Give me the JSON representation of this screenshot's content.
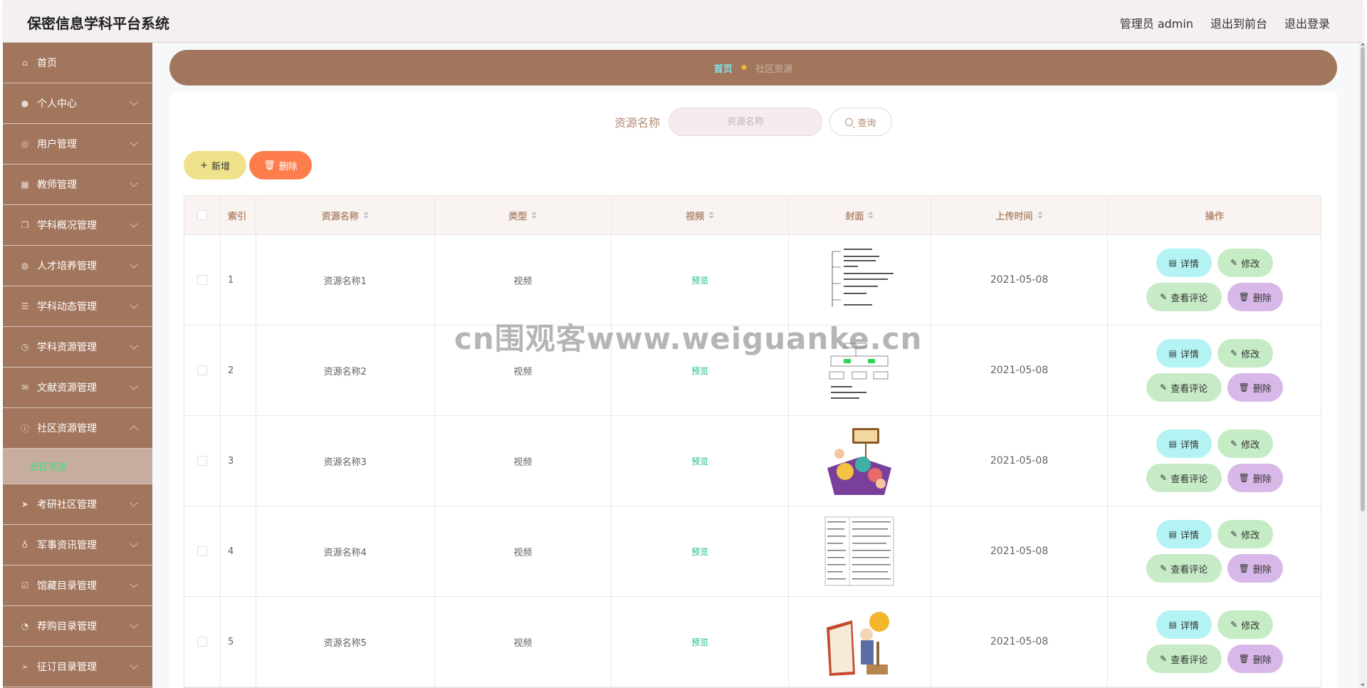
{
  "header": {
    "title": "保密信息学科平台系统",
    "user": "管理员 admin",
    "to_front": "退出到前台",
    "logout": "退出登录"
  },
  "sidebar": {
    "items": [
      {
        "label": "首页",
        "icon": "home-icon"
      },
      {
        "label": "个人中心",
        "icon": "user-icon"
      },
      {
        "label": "用户管理",
        "icon": "users-icon"
      },
      {
        "label": "教师管理",
        "icon": "grid-icon"
      },
      {
        "label": "学科概况管理",
        "icon": "copy-icon"
      },
      {
        "label": "人才培养管理",
        "icon": "globe-icon"
      },
      {
        "label": "学科动态管理",
        "icon": "list-icon"
      },
      {
        "label": "学科资源管理",
        "icon": "clock-icon"
      },
      {
        "label": "文献资源管理",
        "icon": "mail-icon"
      },
      {
        "label": "社区资源管理",
        "icon": "info-icon"
      },
      {
        "label": "考研社区管理",
        "icon": "send-icon"
      },
      {
        "label": "军事资讯管理",
        "icon": "mic-icon"
      },
      {
        "label": "馆藏目录管理",
        "icon": "check-square-icon"
      },
      {
        "label": "荐购目录管理",
        "icon": "speed-icon"
      },
      {
        "label": "征订目录管理",
        "icon": "plane-icon"
      }
    ],
    "sub_item": "社区资源"
  },
  "breadcrumb": {
    "home": "首页",
    "current": "社区资源"
  },
  "search": {
    "label": "资源名称",
    "placeholder": "资源名称",
    "button": "查询"
  },
  "actions": {
    "add": "新增",
    "delete": "删除"
  },
  "table": {
    "headers": {
      "index": "索引",
      "name": "资源名称",
      "type": "类型",
      "video": "视频",
      "cover": "封面",
      "time": "上传时间",
      "ops": "操作"
    },
    "rows": [
      {
        "index": "1",
        "name": "资源名称1",
        "type": "视频",
        "video": "预览",
        "time": "2021-05-08"
      },
      {
        "index": "2",
        "name": "资源名称2",
        "type": "视频",
        "video": "预览",
        "time": "2021-05-08"
      },
      {
        "index": "3",
        "name": "资源名称3",
        "type": "视频",
        "video": "预览",
        "time": "2021-05-08"
      },
      {
        "index": "4",
        "name": "资源名称4",
        "type": "视频",
        "video": "预览",
        "time": "2021-05-08"
      },
      {
        "index": "5",
        "name": "资源名称5",
        "type": "视频",
        "video": "预览",
        "time": "2021-05-08"
      }
    ],
    "ops": {
      "detail": "详情",
      "edit": "修改",
      "comment": "查看评论",
      "delete": "删除"
    }
  },
  "watermark": "cn围观客www.weiguanke.cn",
  "colors": {
    "sidebar": "#a2755d",
    "accent_text": "#b48b73",
    "breadcrumb_home": "#7ee7ef",
    "submenu_active": "#3ce07e",
    "add_button": "#efe28b",
    "delete_button": "#fd7e4c"
  }
}
